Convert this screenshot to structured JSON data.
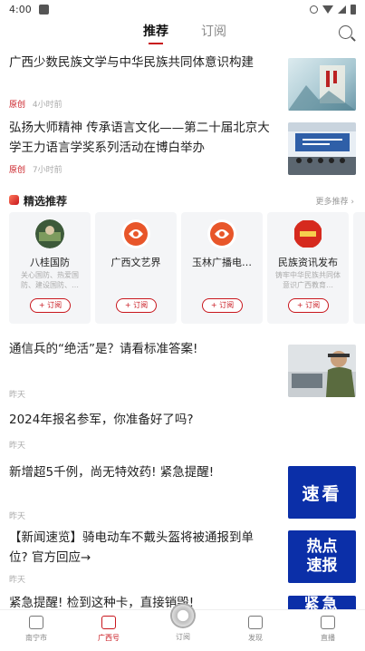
{
  "status_bar": {
    "time": "4:00"
  },
  "top_tabs": {
    "recommend": "推荐",
    "subscribe": "订阅"
  },
  "news_top": [
    {
      "title": "广西少数民族文学与中华民族共同体意识构建",
      "tag": "原创",
      "time": "4小时前"
    },
    {
      "title": "弘扬大师精神 传承语言文化——第二十届北京大学王力语言学奖系列活动在博白举办",
      "tag": "原创",
      "time": "7小时前"
    }
  ],
  "featured": {
    "title": "精选推荐",
    "more": "更多推荐 ›",
    "cards": [
      {
        "name": "八桂国防",
        "desc": "关心国防、热爱国防、建设国防、…",
        "button": "+ 订阅"
      },
      {
        "name": "广西文艺界",
        "desc": "",
        "button": "+ 订阅"
      },
      {
        "name": "玉林广播电…",
        "desc": "",
        "button": "+ 订阅"
      },
      {
        "name": "民族资讯发布",
        "desc": "铸牢中华民族共同体意识广西教育…",
        "button": "+ 订阅"
      }
    ]
  },
  "news_bottom": [
    {
      "title": "通信兵的“绝活”是？请看标准答案!",
      "time": "昨天"
    },
    {
      "title": "2024年报名参军，你准备好了吗?",
      "time": "昨天"
    },
    {
      "title": "新增超5千例，尚无特效药! 紧急提醒!",
      "time": "昨天",
      "thumb_text": "速看"
    },
    {
      "title": "【新闻速览】骑电动车不戴头盔将被通报到单位? 官方回应→",
      "time": "昨天",
      "thumb_text": "热点速报"
    },
    {
      "title": "紧急提醒! 检到这种卡，直接销毁!",
      "time": "",
      "thumb_text": "紧急"
    }
  ],
  "bottom_nav": [
    {
      "label": "南宁市"
    },
    {
      "label": "广西号"
    },
    {
      "label": "订阅"
    },
    {
      "label": "发现"
    },
    {
      "label": "直播"
    }
  ],
  "colors": {
    "accent": "#c8161d",
    "thumb_blue": "#0b2fa8"
  }
}
